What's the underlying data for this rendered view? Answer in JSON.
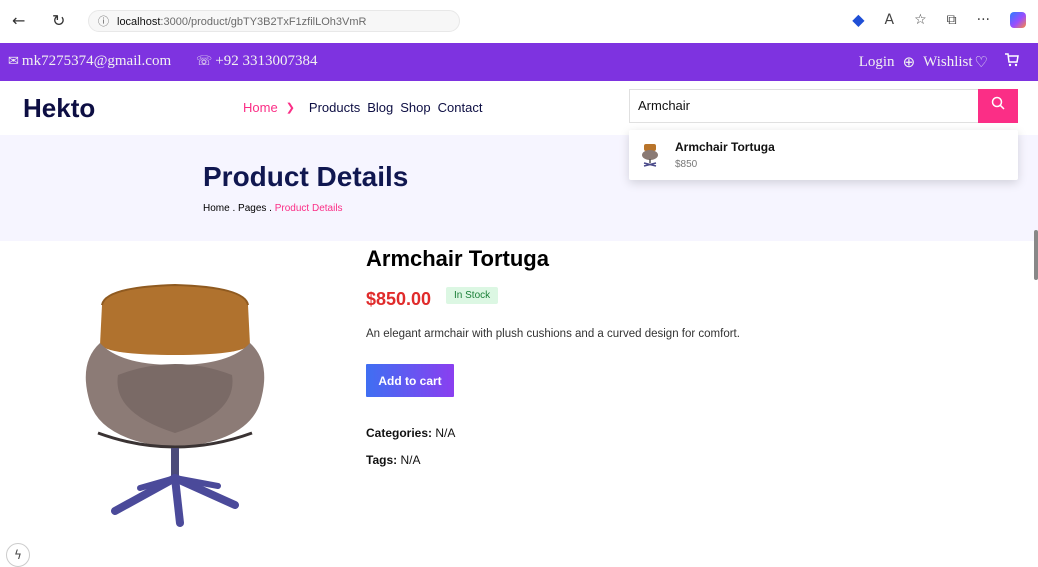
{
  "browser": {
    "back_icon": "←",
    "refresh_icon": "↻",
    "info_icon": "ⓘ",
    "url_host": "localhost",
    "url_path": ":3000/product/gbTY3B2TxF1zfilLOh3VmR",
    "icons": [
      "tag-icon",
      "read-aloud-icon",
      "favorite-icon",
      "collections-icon",
      "more-icon",
      "copilot-icon"
    ],
    "glyph_readaloud": "A",
    "glyph_favorite": "☆",
    "glyph_collections": "⧉",
    "glyph_more": "···",
    "glyph_tag": "◆"
  },
  "topbar": {
    "email": "mk7275374@gmail.com",
    "phone": "+92 3313007384",
    "login": "Login",
    "wishlist": "Wishlist",
    "mail_icon": "✉",
    "phone_icon": "☏",
    "login_icon": "⊕",
    "heart_icon": "♡",
    "cart_icon": "🛒"
  },
  "header": {
    "logo": "Hekto",
    "nav": {
      "home": "Home",
      "products": "Products",
      "blog": "Blog",
      "shop": "Shop",
      "contact": "Contact"
    },
    "search_value": "Armchair",
    "search_icon": "⚲"
  },
  "search_results": [
    {
      "name": "Armchair Tortuga",
      "price": "$850"
    }
  ],
  "banner": {
    "title": "Product Details",
    "crumb_home": "Home",
    "crumb_pages": "Pages",
    "crumb_current": "Product Details",
    "sep": " . "
  },
  "product": {
    "name": "Armchair Tortuga",
    "price": "$850.00",
    "stock": "In Stock",
    "description": "An elegant armchair with plush cushions and a curved design for comfort.",
    "add_to_cart": "Add to cart",
    "categories_label": "Categories:",
    "categories_value": "N/A",
    "tags_label": "Tags:",
    "tags_value": "N/A"
  },
  "colors": {
    "accent_purple": "#7e33e0",
    "accent_pink": "#fb2e86",
    "navy": "#0d0e43",
    "price_red": "#e02b2b"
  },
  "devtools_icon": "ϟ"
}
